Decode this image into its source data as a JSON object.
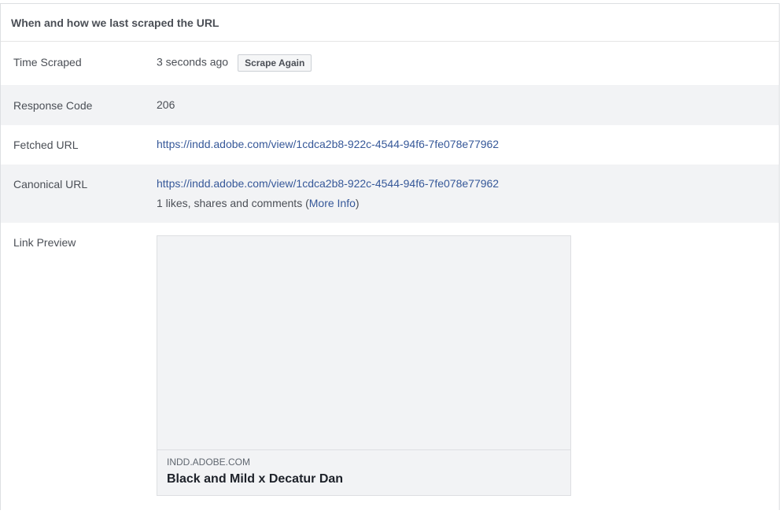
{
  "header": {
    "title": "When and how we last scraped the URL"
  },
  "rows": {
    "time_scraped": {
      "label": "Time Scraped",
      "value": "3 seconds ago",
      "button_label": "Scrape Again"
    },
    "response_code": {
      "label": "Response Code",
      "value": "206"
    },
    "fetched_url": {
      "label": "Fetched URL",
      "value": "https://indd.adobe.com/view/1cdca2b8-922c-4544-94f6-7fe078e77962"
    },
    "canonical_url": {
      "label": "Canonical URL",
      "value": "https://indd.adobe.com/view/1cdca2b8-922c-4544-94f6-7fe078e77962",
      "engagement_prefix": "1 likes, shares and comments (",
      "more_info_label": "More Info",
      "engagement_suffix": ")"
    },
    "link_preview": {
      "label": "Link Preview",
      "domain": "INDD.ADOBE.COM",
      "title": "Black and Mild x Decatur Dan"
    }
  },
  "colors": {
    "link": "#365899",
    "alt_row_bg": "#f2f3f5",
    "text": "#4b4f56"
  }
}
